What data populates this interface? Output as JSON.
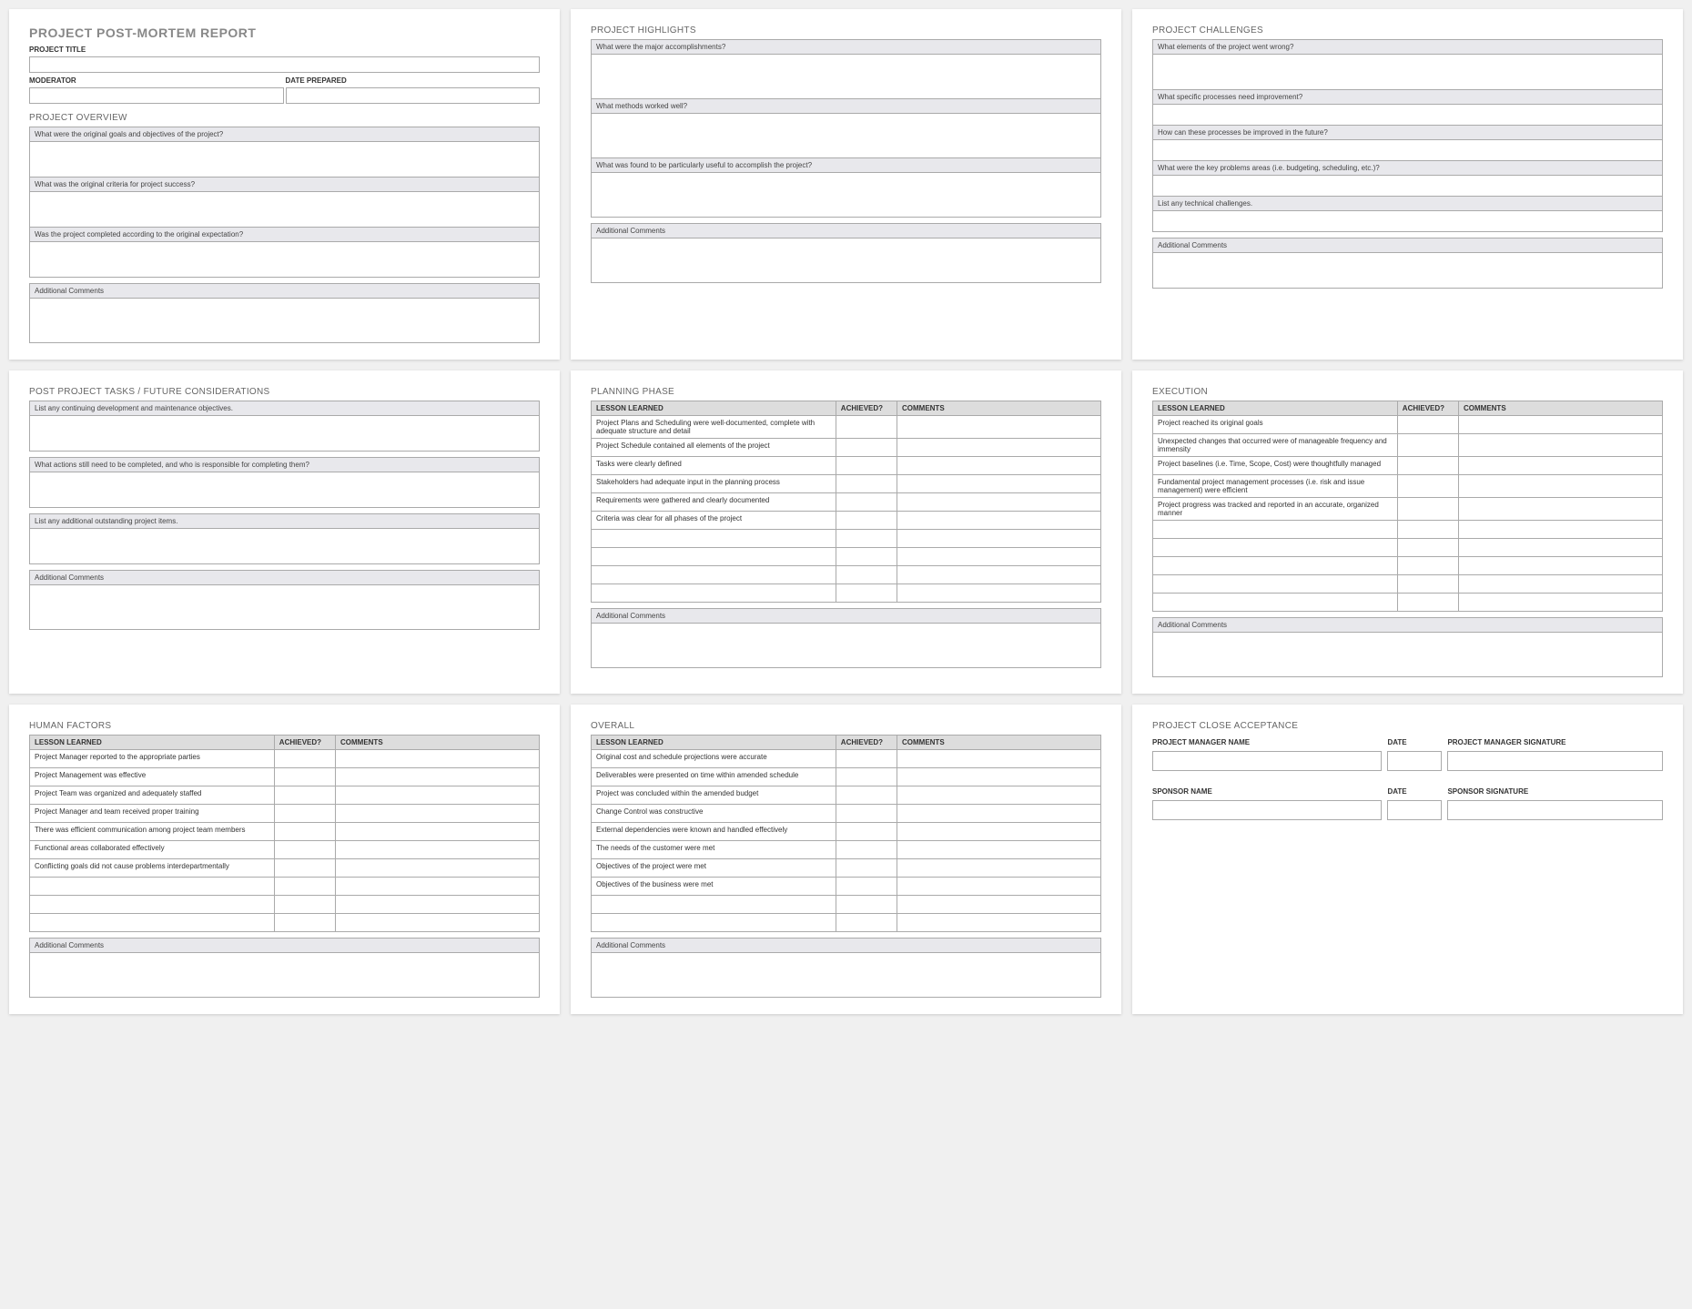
{
  "titles": {
    "report": "PROJECT POST-MORTEM REPORT",
    "project_title": "PROJECT TITLE",
    "moderator": "MODERATOR",
    "date_prepared": "DATE PREPARED",
    "project_overview": "PROJECT OVERVIEW",
    "highlights": "PROJECT HIGHLIGHTS",
    "challenges": "PROJECT CHALLENGES",
    "future": "POST PROJECT TASKS / FUTURE CONSIDERATIONS",
    "planning": "PLANNING PHASE",
    "execution": "EXECUTION",
    "human": "HUMAN FACTORS",
    "overall": "OVERALL",
    "acceptance": "PROJECT CLOSE ACCEPTANCE",
    "additional_comments": "Additional Comments"
  },
  "overview": {
    "q1": "What were the original goals and objectives of the project?",
    "q2": "What was the original criteria for project success?",
    "q3": "Was the project completed according to the original expectation?"
  },
  "highlights": {
    "q1": "What were the major accomplishments?",
    "q2": "What methods worked well?",
    "q3": "What was found to be particularly useful to accomplish the project?"
  },
  "challenges": {
    "q1": "What elements of the project went wrong?",
    "q2": "What specific processes need improvement?",
    "q3": "How can these processes be improved in the future?",
    "q4": "What were the key problems areas (i.e. budgeting, scheduling, etc.)?",
    "q5": "List any technical challenges."
  },
  "future": {
    "q1": "List any continuing development and maintenance objectives.",
    "q2": "What actions still need to be completed, and who is responsible for completing them?",
    "q3": "List any additional outstanding project items."
  },
  "table_headers": {
    "lesson": "LESSON LEARNED",
    "achieved": "ACHIEVED?",
    "comments": "COMMENTS"
  },
  "planning_rows": [
    "Project Plans and Scheduling were well-documented, complete with adequate structure and detail",
    "Project Schedule contained all elements of the project",
    "Tasks were clearly defined",
    "Stakeholders had adequate input in the planning process",
    "Requirements were gathered and clearly documented",
    "Criteria was clear for all phases of the project",
    "",
    "",
    "",
    ""
  ],
  "execution_rows": [
    "Project reached its original goals",
    "Unexpected changes that occurred were of manageable frequency and immensity",
    "Project baselines (i.e. Time, Scope, Cost) were thoughtfully managed",
    "Fundamental project management processes (i.e. risk and issue management) were efficient",
    "Project progress was tracked and reported in an accurate, organized manner",
    "",
    "",
    "",
    "",
    ""
  ],
  "human_rows": [
    "Project Manager reported to the appropriate parties",
    "Project Management was effective",
    "Project Team was organized and adequately staffed",
    "Project Manager and team received proper training",
    "There was efficient communication among project team members",
    "Functional areas collaborated effectively",
    "Conflicting goals did not cause problems interdepartmentally",
    "",
    "",
    ""
  ],
  "overall_rows": [
    "Original cost and schedule projections were accurate",
    "Deliverables were presented on time within amended schedule",
    "Project was concluded within the amended budget",
    "Change Control was constructive",
    "External dependencies were known and handled effectively",
    "The needs of the customer were met",
    "Objectives of the project were met",
    "Objectives of the business were met",
    "",
    ""
  ],
  "acceptance": {
    "pm_name": "PROJECT MANAGER NAME",
    "date": "DATE",
    "pm_sig": "PROJECT MANAGER SIGNATURE",
    "sponsor_name": "SPONSOR NAME",
    "sponsor_sig": "SPONSOR SIGNATURE"
  }
}
